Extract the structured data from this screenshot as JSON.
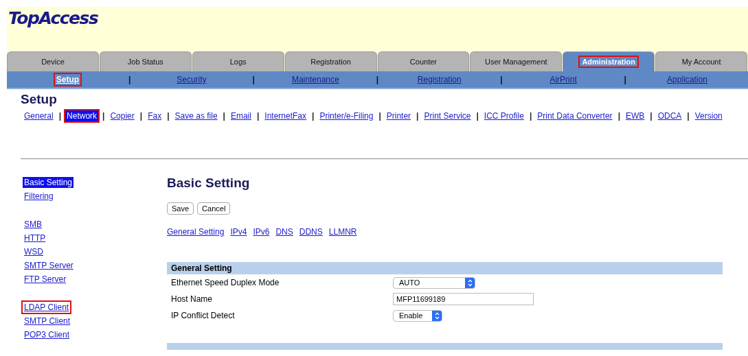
{
  "logo": "TopAccess",
  "tabs": [
    {
      "label": "Device",
      "selected": false,
      "highlighted": false
    },
    {
      "label": "Job Status",
      "selected": false,
      "highlighted": false
    },
    {
      "label": "Logs",
      "selected": false,
      "highlighted": false
    },
    {
      "label": "Registration",
      "selected": false,
      "highlighted": false
    },
    {
      "label": "Counter",
      "selected": false,
      "highlighted": false
    },
    {
      "label": "User Management",
      "selected": false,
      "highlighted": false
    },
    {
      "label": "Administration",
      "selected": true,
      "highlighted": true
    },
    {
      "label": "My Account",
      "selected": false,
      "highlighted": false
    }
  ],
  "subnav": [
    {
      "label": "Setup",
      "selected": true,
      "highlighted": true
    },
    {
      "label": "Security",
      "selected": false,
      "highlighted": false
    },
    {
      "label": "Maintenance",
      "selected": false,
      "highlighted": false
    },
    {
      "label": "Registration",
      "selected": false,
      "highlighted": false
    },
    {
      "label": "AirPrint",
      "selected": false,
      "highlighted": false
    },
    {
      "label": "Application",
      "selected": false,
      "highlighted": false
    }
  ],
  "subnav_separator": "|",
  "page_title": "Setup",
  "setup_separator": "|",
  "setup_links": [
    {
      "label": "General",
      "selected": false,
      "highlighted": false
    },
    {
      "label": "Network",
      "selected": true,
      "highlighted": true
    },
    {
      "label": "Copier",
      "selected": false,
      "highlighted": false
    },
    {
      "label": "Fax",
      "selected": false,
      "highlighted": false
    },
    {
      "label": "Save as file",
      "selected": false,
      "highlighted": false
    },
    {
      "label": "Email",
      "selected": false,
      "highlighted": false
    },
    {
      "label": "InternetFax",
      "selected": false,
      "highlighted": false
    },
    {
      "label": "Printer/e-Filing",
      "selected": false,
      "highlighted": false
    },
    {
      "label": "Printer",
      "selected": false,
      "highlighted": false
    },
    {
      "label": "Print Service",
      "selected": false,
      "highlighted": false
    },
    {
      "label": "ICC Profile",
      "selected": false,
      "highlighted": false
    },
    {
      "label": "Print Data Converter",
      "selected": false,
      "highlighted": false
    },
    {
      "label": "EWB",
      "selected": false,
      "highlighted": false
    },
    {
      "label": "ODCA",
      "selected": false,
      "highlighted": false
    },
    {
      "label": "Version",
      "selected": false,
      "highlighted": false
    }
  ],
  "sidebar": {
    "groups": [
      [
        {
          "label": "Basic Setting",
          "selected": true,
          "highlighted": false
        },
        {
          "label": "Filtering",
          "selected": false,
          "highlighted": false
        }
      ],
      [
        {
          "label": "SMB",
          "selected": false,
          "highlighted": false
        },
        {
          "label": "HTTP",
          "selected": false,
          "highlighted": false
        },
        {
          "label": "WSD",
          "selected": false,
          "highlighted": false
        },
        {
          "label": "SMTP Server",
          "selected": false,
          "highlighted": false
        },
        {
          "label": "FTP Server",
          "selected": false,
          "highlighted": false
        }
      ],
      [
        {
          "label": "LDAP Client",
          "selected": false,
          "highlighted": true
        },
        {
          "label": "SMTP Client",
          "selected": false,
          "highlighted": false
        },
        {
          "label": "POP3 Client",
          "selected": false,
          "highlighted": false
        }
      ]
    ]
  },
  "main": {
    "title": "Basic Setting",
    "buttons": [
      "Save",
      "Cancel"
    ],
    "anchors": [
      "General Setting",
      "IPv4",
      "IPv6",
      "DNS",
      "DDNS",
      "LLMNR"
    ],
    "section": {
      "title": "General Setting",
      "rows": [
        {
          "label": "Ethernet Speed Duplex Mode",
          "kind": "select",
          "value": "AUTO"
        },
        {
          "label": "Host Name",
          "kind": "text",
          "value": "MFP11699189"
        },
        {
          "label": "IP Conflict Detect",
          "kind": "select",
          "value": "Enable"
        }
      ]
    }
  }
}
